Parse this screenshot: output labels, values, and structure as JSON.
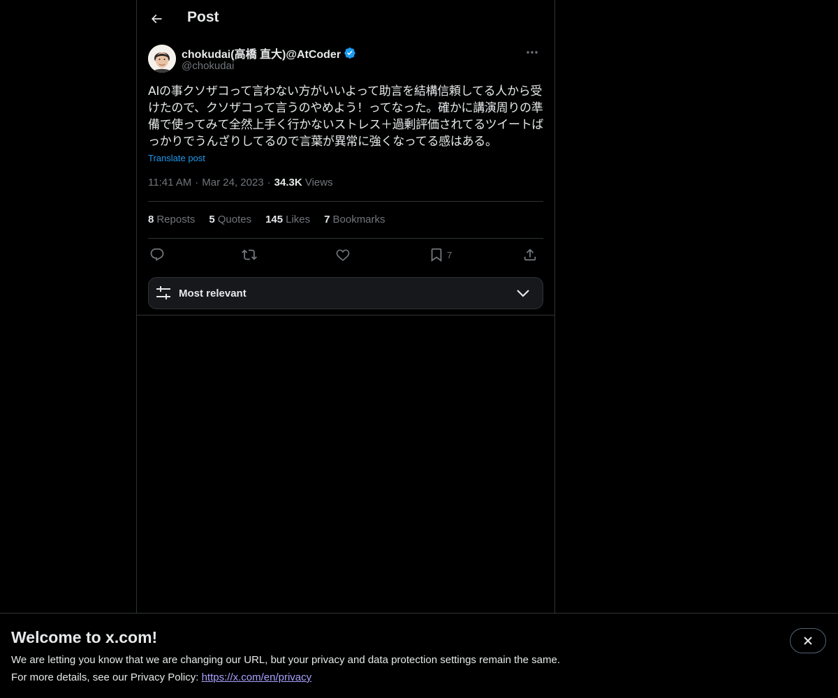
{
  "header": {
    "title": "Post"
  },
  "author": {
    "display_name": "chokudai(高橋 直大)@AtCoder",
    "handle": "@chokudai",
    "verified": true
  },
  "post": {
    "text": "AIの事クソザコって言わない方がいいよって助言を結構信頼してる人から受けたので、クソザコって言うのやめよう！ってなった。確かに講演周りの準備で使ってみて全然上手く行かないストレス＋過剰評価されてるツイートばっかりでうんざりしてるので言葉が異常に強くなってる感はある。",
    "translate_label": "Translate post",
    "time": "11:41 AM",
    "date": "Mar 24, 2023",
    "views_count": "34.3K",
    "views_label": "Views",
    "separator": "·"
  },
  "stats": [
    {
      "count": "8",
      "label": "Reposts"
    },
    {
      "count": "5",
      "label": "Quotes"
    },
    {
      "count": "145",
      "label": "Likes"
    },
    {
      "count": "7",
      "label": "Bookmarks"
    }
  ],
  "actions": {
    "bookmark_count": "7"
  },
  "sort": {
    "label": "Most relevant"
  },
  "banner": {
    "title": "Welcome to x.com!",
    "line1": "We are letting you know that we are changing our URL, but your privacy and data protection settings remain the same.",
    "line2_prefix": "For more details, see our Privacy Policy: ",
    "link": "https://x.com/en/privacy"
  },
  "colors": {
    "accent": "#1d9bf0",
    "background": "#000000",
    "text": "#e7e9ea",
    "muted": "#71767b",
    "link": "#a8a2ff"
  }
}
